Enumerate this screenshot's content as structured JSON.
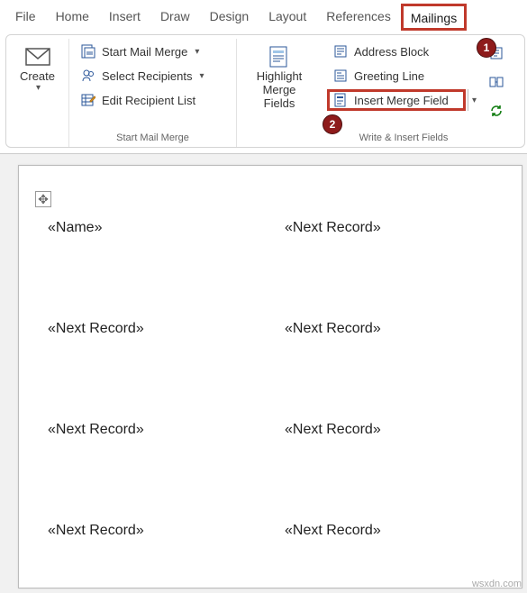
{
  "tabs": {
    "file": "File",
    "home": "Home",
    "insert": "Insert",
    "draw": "Draw",
    "design": "Design",
    "layout": "Layout",
    "references": "References",
    "mailings": "Mailings"
  },
  "callouts": {
    "one": "1",
    "two": "2"
  },
  "ribbon": {
    "create": {
      "label": "Create"
    },
    "start_merge_group": {
      "label": "Start Mail Merge",
      "start_mail_merge": "Start Mail Merge",
      "select_recipients": "Select Recipients",
      "edit_recipient_list": "Edit Recipient List"
    },
    "highlight_merge": {
      "line1": "Highlight",
      "line2": "Merge Fields"
    },
    "write_insert_group": {
      "label": "Write & Insert Fields",
      "address_block": "Address Block",
      "greeting_line": "Greeting Line",
      "insert_merge_field": "Insert Merge Field"
    }
  },
  "doc": {
    "fields": [
      "«Name»",
      "«Next Record»",
      "«Next Record»",
      "«Next Record»",
      "«Next Record»",
      "«Next Record»",
      "«Next Record»",
      "«Next Record»"
    ]
  },
  "watermark": "wsxdn.com"
}
